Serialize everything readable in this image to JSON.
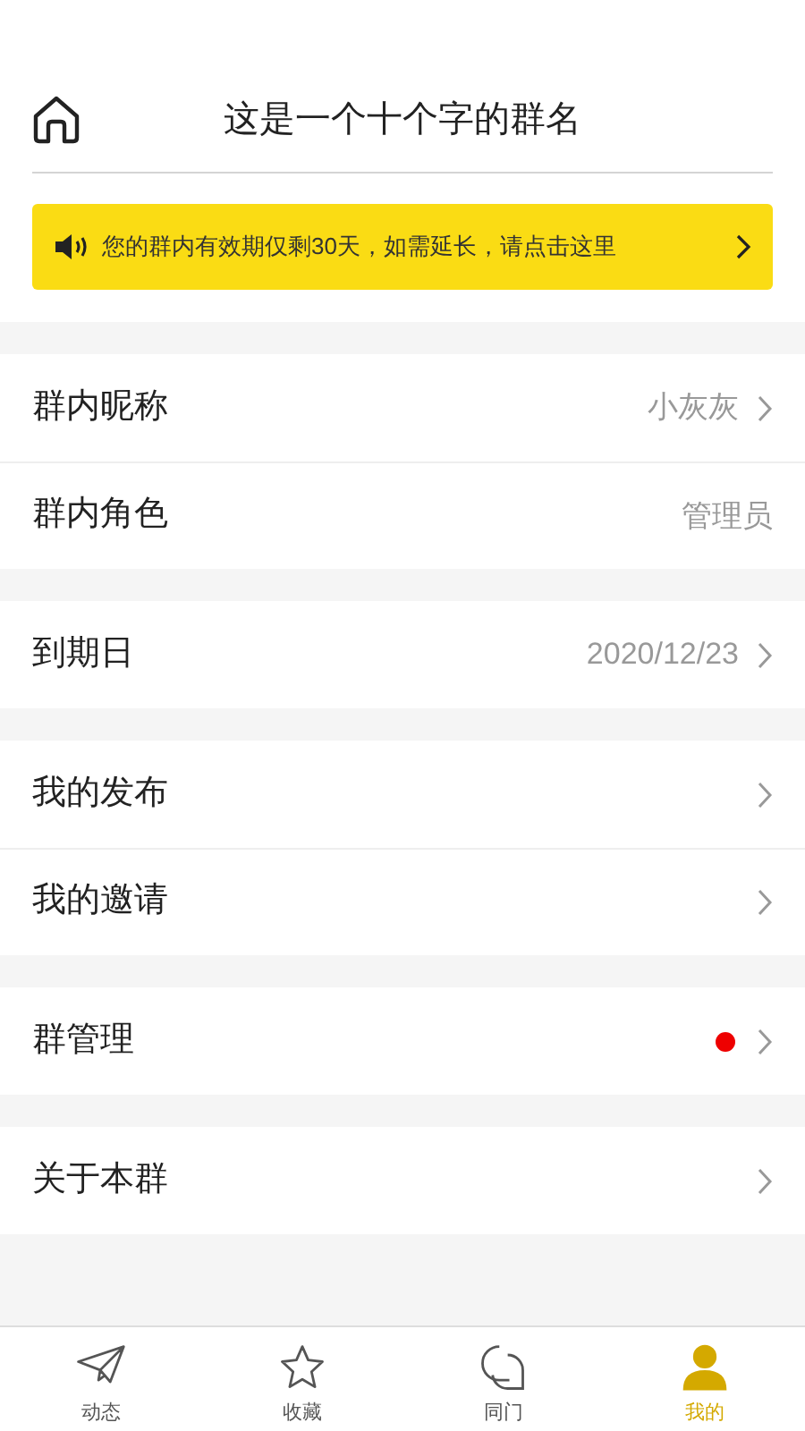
{
  "header": {
    "title": "这是一个十个字的群名"
  },
  "notice": {
    "text": "您的群内有效期仅剩30天，如需延长，请点击这里"
  },
  "groups": [
    {
      "rows": [
        {
          "label": "群内昵称",
          "value": "小灰灰",
          "arrow": true,
          "dot": false
        },
        {
          "label": "群内角色",
          "value": "管理员",
          "arrow": false,
          "dot": false
        }
      ]
    },
    {
      "rows": [
        {
          "label": "到期日",
          "value": "2020/12/23",
          "arrow": true,
          "dot": false
        }
      ]
    },
    {
      "rows": [
        {
          "label": "我的发布",
          "arrow": true,
          "dot": false
        },
        {
          "label": "我的邀请",
          "arrow": true,
          "dot": false
        }
      ]
    },
    {
      "rows": [
        {
          "label": "群管理",
          "arrow": true,
          "dot": true
        }
      ]
    },
    {
      "rows": [
        {
          "label": "关于本群",
          "arrow": true,
          "dot": false
        }
      ]
    }
  ],
  "tabs": [
    {
      "label": "动态",
      "kind": "plane",
      "selected": false
    },
    {
      "label": "收藏",
      "kind": "star",
      "selected": false
    },
    {
      "label": "同门",
      "kind": "chat",
      "selected": false
    },
    {
      "label": "我的",
      "kind": "person",
      "selected": true
    }
  ]
}
